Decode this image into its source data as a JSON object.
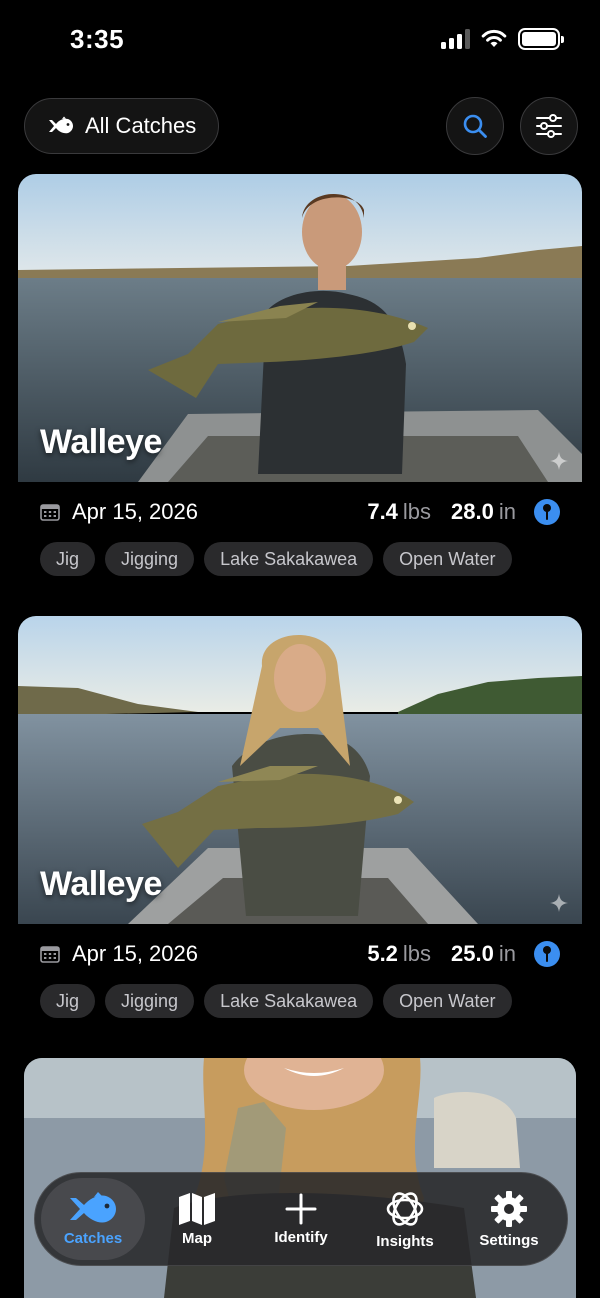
{
  "status_bar": {
    "time": "3:35"
  },
  "header": {
    "filter_label": "All Catches"
  },
  "catches": [
    {
      "species": "Walleye",
      "date": "Apr 15, 2026",
      "weight": "7.4",
      "weight_unit": "lbs",
      "length": "28.0",
      "length_unit": "in",
      "tags": [
        "Jig",
        "Jigging",
        "Lake Sakakawea",
        "Open Water"
      ]
    },
    {
      "species": "Walleye",
      "date": "Apr 15, 2026",
      "weight": "5.2",
      "weight_unit": "lbs",
      "length": "25.0",
      "length_unit": "in",
      "tags": [
        "Jig",
        "Jigging",
        "Lake Sakakawea",
        "Open Water"
      ]
    }
  ],
  "tab_bar": {
    "items": [
      {
        "label": "Catches",
        "icon": "fish-icon",
        "active": true
      },
      {
        "label": "Map",
        "icon": "map-icon",
        "active": false
      },
      {
        "label": "Identify",
        "icon": "plus-icon",
        "active": false
      },
      {
        "label": "Insights",
        "icon": "atom-icon",
        "active": false
      },
      {
        "label": "Settings",
        "icon": "gear-icon",
        "active": false
      }
    ]
  },
  "colors": {
    "accent": "#4aa3ff",
    "pin": "#3b8ef0",
    "background": "#000000",
    "tag_bg": "#2a2a2c"
  }
}
